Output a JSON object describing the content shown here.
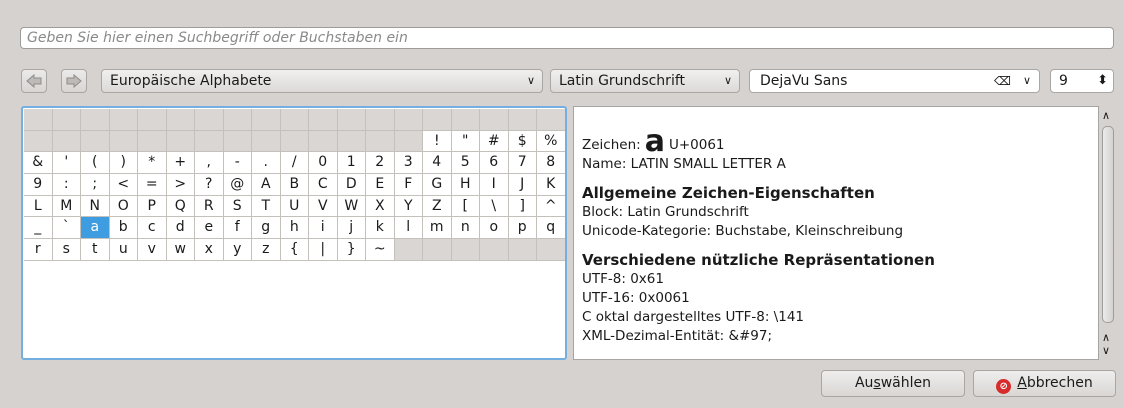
{
  "search": {
    "placeholder": "Geben Sie hier einen Suchbegriff oder Buchstaben ein"
  },
  "toolbar": {
    "back_icon": "arrow-left-icon",
    "forward_icon": "arrow-right-icon",
    "section": "Europäische Alphabete",
    "block": "Latin Grundschrift",
    "font": "DejaVu Sans",
    "font_size": "9"
  },
  "grid": {
    "rows": [
      [
        "",
        "",
        "",
        "",
        "",
        "",
        "",
        "",
        "",
        "",
        "",
        "",
        "",
        "",
        "",
        "",
        "",
        "",
        ""
      ],
      [
        "",
        "",
        "",
        "",
        "",
        "",
        "",
        "",
        "",
        "",
        "",
        "",
        "",
        "",
        "!",
        "\"",
        "#",
        "$",
        "%"
      ],
      [
        "&",
        "'",
        "(",
        ")",
        "*",
        "+",
        ",",
        "-",
        ".",
        "/",
        "0",
        "1",
        "2",
        "3",
        "4",
        "5",
        "6",
        "7",
        "8"
      ],
      [
        "9",
        ":",
        ";",
        "<",
        "=",
        ">",
        "?",
        "@",
        "A",
        "B",
        "C",
        "D",
        "E",
        "F",
        "G",
        "H",
        "I",
        "J",
        "K"
      ],
      [
        "L",
        "M",
        "N",
        "O",
        "P",
        "Q",
        "R",
        "S",
        "T",
        "U",
        "V",
        "W",
        "X",
        "Y",
        "Z",
        "[",
        "\\",
        "]",
        "^"
      ],
      [
        "_",
        "`",
        "a",
        "b",
        "c",
        "d",
        "e",
        "f",
        "g",
        "h",
        "i",
        "j",
        "k",
        "l",
        "m",
        "n",
        "o",
        "p",
        "q"
      ],
      [
        "r",
        "s",
        "t",
        "u",
        "v",
        "w",
        "x",
        "y",
        "z",
        "{",
        "|",
        "}",
        "~",
        "",
        "",
        "",
        "",
        "",
        ""
      ]
    ],
    "selected": "a"
  },
  "info": {
    "char_label": "Zeichen:",
    "char": "a",
    "codepoint": "U+0061",
    "name_line": "Name: LATIN SMALL LETTER A",
    "general_heading": "Allgemeine Zeichen-Eigenschaften",
    "block_line": "Block: Latin Grundschrift",
    "category_line": "Unicode-Kategorie: Buchstabe, Kleinschreibung",
    "repr_heading": "Verschiedene nützliche Repräsentationen",
    "utf8_line": "UTF-8: 0x61",
    "utf16_line": "UTF-16: 0x0061",
    "octal_line": "C oktal dargestelltes UTF-8: \\141",
    "xml_line": "XML-Dezimal-Entität: &#97;"
  },
  "buttons": {
    "select_pre": "Au",
    "select_mn": "s",
    "select_post": "wählen",
    "cancel_mn": "A",
    "cancel_post": "bbrechen",
    "cancel_icon": "cancel-icon"
  }
}
